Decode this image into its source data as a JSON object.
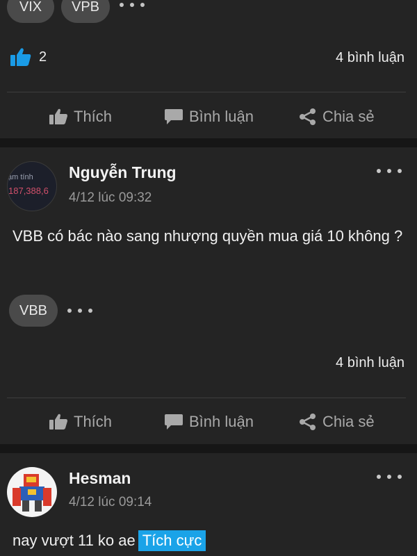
{
  "post_prev": {
    "tags": [
      "VIX",
      "VPB"
    ],
    "like_count": "2",
    "comment_count": "4 bình luận"
  },
  "actions": {
    "like": "Thích",
    "comment": "Bình luận",
    "share": "Chia sẻ"
  },
  "post_1": {
    "author": "Nguyễn Trung",
    "timestamp": "4/12 lúc 09:32",
    "avatar_line1": "ạm tính",
    "avatar_line2": "187,388,6",
    "content": "VBB có bác nào sang nhượng quyền mua giá 10 không ?",
    "tags": [
      "VBB"
    ],
    "comment_count": "4 bình luận"
  },
  "post_2": {
    "author": "Hesman",
    "timestamp": "4/12 lúc 09:14",
    "content": "nay vượt 11 ko ae",
    "sentiment": "Tích cực"
  },
  "colors": {
    "background": "#161616",
    "card": "#242424",
    "like_blue": "#1a9be6",
    "sentiment_bg": "#1aa3e8",
    "chip": "#4a4a4a"
  }
}
